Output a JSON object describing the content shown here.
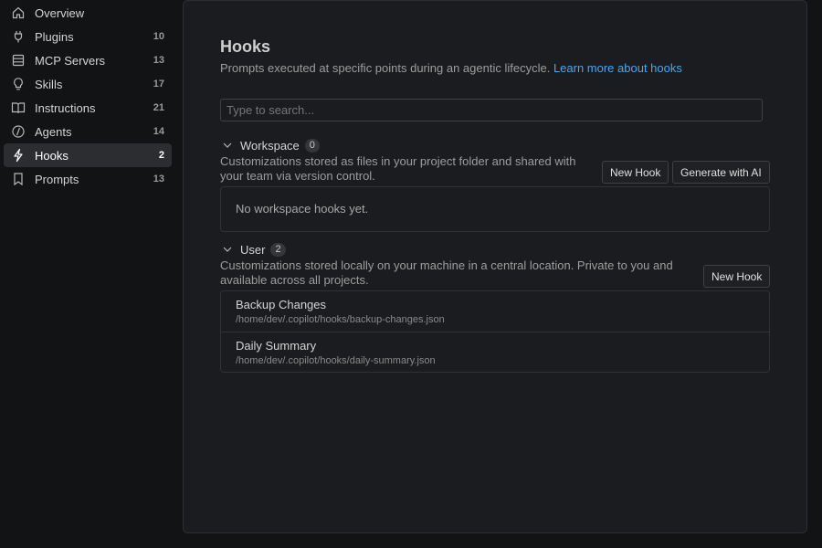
{
  "sidebar": {
    "items": [
      {
        "label": "Overview",
        "count": "",
        "icon": "home-icon"
      },
      {
        "label": "Plugins",
        "count": "10",
        "icon": "plug-icon"
      },
      {
        "label": "MCP Servers",
        "count": "13",
        "icon": "server-icon"
      },
      {
        "label": "Skills",
        "count": "17",
        "icon": "lightbulb-icon"
      },
      {
        "label": "Instructions",
        "count": "21",
        "icon": "book-icon"
      },
      {
        "label": "Agents",
        "count": "14",
        "icon": "agent-icon"
      },
      {
        "label": "Hooks",
        "count": "2",
        "icon": "lightning-icon",
        "active": true
      },
      {
        "label": "Prompts",
        "count": "13",
        "icon": "bookmark-icon"
      }
    ]
  },
  "main": {
    "title": "Hooks",
    "subtitle": "Prompts executed at specific points during an agentic lifecycle.",
    "learn_more": "Learn more about hooks",
    "search_placeholder": "Type to search...",
    "workspace": {
      "title": "Workspace",
      "count": "0",
      "description": "Customizations stored as files in your project folder and shared with your team via version control.",
      "new_hook_label": "New Hook",
      "generate_label": "Generate with AI",
      "empty_text": "No workspace hooks yet."
    },
    "user": {
      "title": "User",
      "count": "2",
      "description": "Customizations stored locally on your machine in a central location. Private to you and available across all projects.",
      "new_hook_label": "New Hook",
      "hooks": [
        {
          "name": "Backup Changes",
          "path": "/home/dev/.copilot/hooks/backup-changes.json"
        },
        {
          "name": "Daily Summary",
          "path": "/home/dev/.copilot/hooks/daily-summary.json"
        }
      ]
    }
  },
  "colors": {
    "link": "#4fa5e8",
    "active_bg": "#2b2d31",
    "panel_bg": "#1b1c1f",
    "app_bg": "#121315"
  }
}
